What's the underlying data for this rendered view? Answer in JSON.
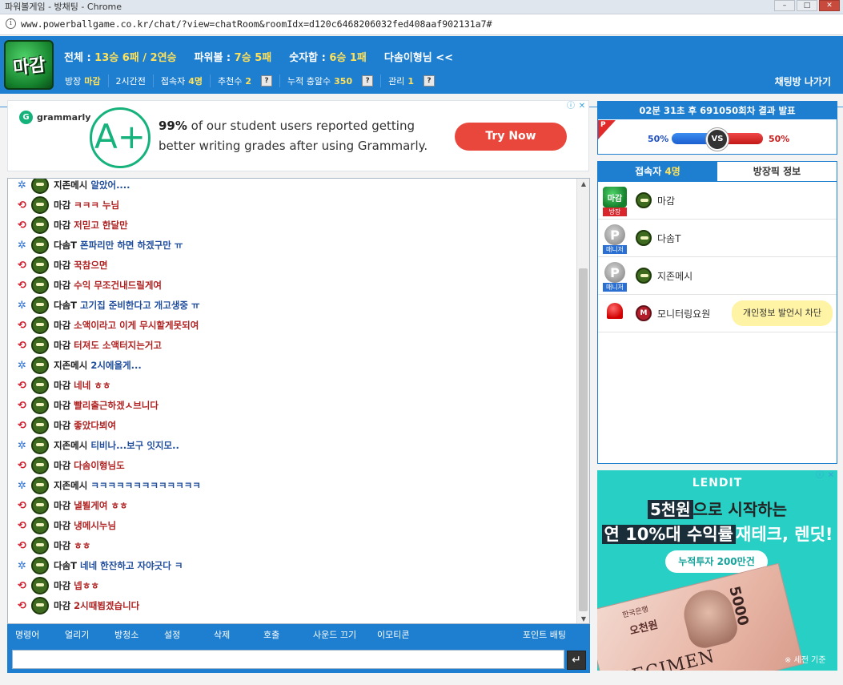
{
  "window": {
    "title": "파워볼게임 - 방채팅 - Chrome"
  },
  "browser": {
    "url": "www.powerballgame.co.kr/chat/?view=chatRoom&roomIdx=d120c6468206032fed408aaf902131a7#"
  },
  "header": {
    "logo_text": "마감",
    "stats": [
      {
        "label": "전체 : ",
        "value": "13승 6패 / 2연승"
      },
      {
        "label": "파워볼 : ",
        "value": "7승 5패"
      },
      {
        "label": "숫자합 : ",
        "value": "6승 1패"
      },
      {
        "label": "다솜이형님 <<",
        "value": ""
      }
    ],
    "sub": {
      "owner_label": "방장",
      "owner_value": "마감",
      "duration": "2시간전",
      "users_label": "접속자",
      "users_value": "4명",
      "reco_label": "추천수",
      "reco_value": "2",
      "accum_label": "누적 충알수",
      "accum_value": "350",
      "admin_label": "관리",
      "admin_value": "1",
      "help": "?"
    },
    "exit_label": "채팅방 나가기"
  },
  "ad_top": {
    "brand": "grammarly",
    "line1_bold": "99%",
    "line1_rest": " of our student users reported getting",
    "line2": "better writing grades after using Grammarly.",
    "cta": "Try Now",
    "aplus": "A+"
  },
  "chat": {
    "messages": [
      {
        "team": "blue",
        "nick": "지존메시",
        "text": "알았어....",
        "color": "blue"
      },
      {
        "team": "red",
        "nick": "마감",
        "text": "ㅋㅋㅋ 누님",
        "color": "red"
      },
      {
        "team": "red",
        "nick": "마감",
        "text": "저믿고 한달만",
        "color": "red"
      },
      {
        "team": "blue",
        "nick": "다솜T",
        "text": "폰파리만 하면 하겠구만 ㅠ",
        "color": "blue"
      },
      {
        "team": "red",
        "nick": "마감",
        "text": "꾹참으면",
        "color": "red"
      },
      {
        "team": "red",
        "nick": "마감",
        "text": "수익 무조건내드릴게여",
        "color": "red"
      },
      {
        "team": "blue",
        "nick": "다솜T",
        "text": "고기집 준비한다고 개고생중 ㅠ",
        "color": "blue"
      },
      {
        "team": "red",
        "nick": "마감",
        "text": "소액이라고 이게 무시할게못되여",
        "color": "red"
      },
      {
        "team": "red",
        "nick": "마감",
        "text": "터져도 소액터지는거고",
        "color": "red"
      },
      {
        "team": "blue",
        "nick": "지존메시",
        "text": "2시에올게...",
        "color": "blue"
      },
      {
        "team": "red",
        "nick": "마감",
        "text": "네네 ㅎㅎ",
        "color": "red"
      },
      {
        "team": "red",
        "nick": "마감",
        "text": "빨리출근하겠ㅅ브니다",
        "color": "red"
      },
      {
        "team": "red",
        "nick": "마감",
        "text": "좋았다뵈여",
        "color": "red"
      },
      {
        "team": "blue",
        "nick": "지존메시",
        "text": "티비나...보구 잇지모..",
        "color": "blue"
      },
      {
        "team": "red",
        "nick": "마감",
        "text": "다솜이형님도",
        "color": "red"
      },
      {
        "team": "blue",
        "nick": "지존메시",
        "text": "ㅋㅋㅋㅋㅋㅋㅋㅋㅋㅋㅋㅋㅋ",
        "color": "blue"
      },
      {
        "team": "red",
        "nick": "마감",
        "text": "낼뵐게여 ㅎㅎ",
        "color": "red"
      },
      {
        "team": "red",
        "nick": "마감",
        "text": "냉메시누님",
        "color": "red"
      },
      {
        "team": "red",
        "nick": "마감",
        "text": "ㅎㅎ",
        "color": "red"
      },
      {
        "team": "blue",
        "nick": "다솜T",
        "text": "네네 한잔하고 자야긋다 ㅋ",
        "color": "blue"
      },
      {
        "team": "red",
        "nick": "마감",
        "text": "넵ㅎㅎ",
        "color": "red"
      },
      {
        "team": "red",
        "nick": "마감",
        "text": "2시때뵙겠습니다",
        "color": "red"
      }
    ],
    "toolbar": [
      "명령어",
      "얼리기",
      "방청소",
      "설정",
      "삭제",
      "호출",
      "사운드 끄기",
      "이모티콘"
    ],
    "toolbar_right": "포인트 배팅",
    "input_value": "",
    "send_icon": "↵"
  },
  "result": {
    "title": "02분 31초 후 691050회차 결과 발표",
    "flag": "P",
    "left_pct": "50%",
    "right_pct": "50%",
    "left_share": 50,
    "vs": "VS"
  },
  "users": {
    "tab_active_label": "접속자 ",
    "tab_active_count": "4명",
    "tab_inactive": "방장픽 정보",
    "list": [
      {
        "badge": "방장",
        "badge_color": "red",
        "kind": "owner",
        "pic_text": "마감",
        "name": "마감",
        "bubble": ""
      },
      {
        "badge": "매니저",
        "badge_color": "blue",
        "kind": "mgr",
        "pic_text": "P",
        "name": "다솜T",
        "bubble": ""
      },
      {
        "badge": "매니저",
        "badge_color": "blue",
        "kind": "mgr",
        "pic_text": "P",
        "name": "지존메시",
        "bubble": ""
      },
      {
        "badge": "",
        "badge_color": "",
        "kind": "siren",
        "pic_text": "",
        "name": "모니터링요원",
        "bubble": "개인정보 발언시 차단",
        "mav": "M"
      }
    ]
  },
  "ad_side": {
    "brand": "LENDIT",
    "line1_hl": "5천원",
    "line1_rest": "으로 시작하는",
    "line2_hl": "연 10%대 수익률",
    "line2_rest": "재테크, 렌딧!",
    "pill": "누적투자 200만건",
    "bill_bank": "한국은행",
    "bill_won": "오천원",
    "bill_spec": "SPECIMEN",
    "bill_num": "5000",
    "note": "※ 세전 기준"
  },
  "colors": {
    "accent": "#1e7fd0",
    "yellow": "#ffe15a",
    "red": "#c71f1f",
    "blue": "#1f4fbf"
  }
}
